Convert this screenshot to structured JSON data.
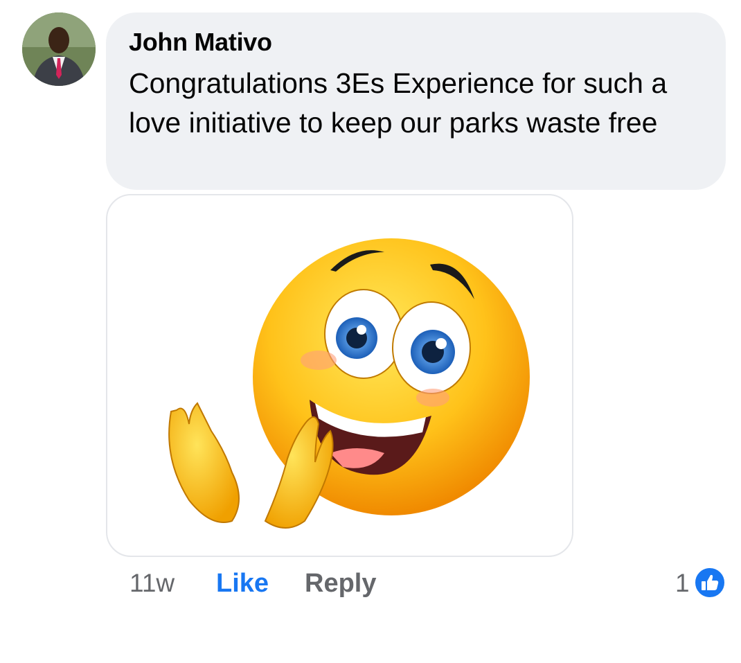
{
  "comment": {
    "author": "John Mativo",
    "text": "Congratulations 3Es Experience for such a love initiative to keep our parks waste free",
    "sticker": "clapping-smiley-emoji"
  },
  "actions": {
    "time": "11w",
    "like_label": "Like",
    "reply_label": "Reply",
    "reaction_count": "1",
    "reaction_icon": "thumbs-up-icon"
  },
  "colors": {
    "like_blue": "#1877f2",
    "bubble_bg": "#eff1f4",
    "meta_gray": "#65676b"
  }
}
